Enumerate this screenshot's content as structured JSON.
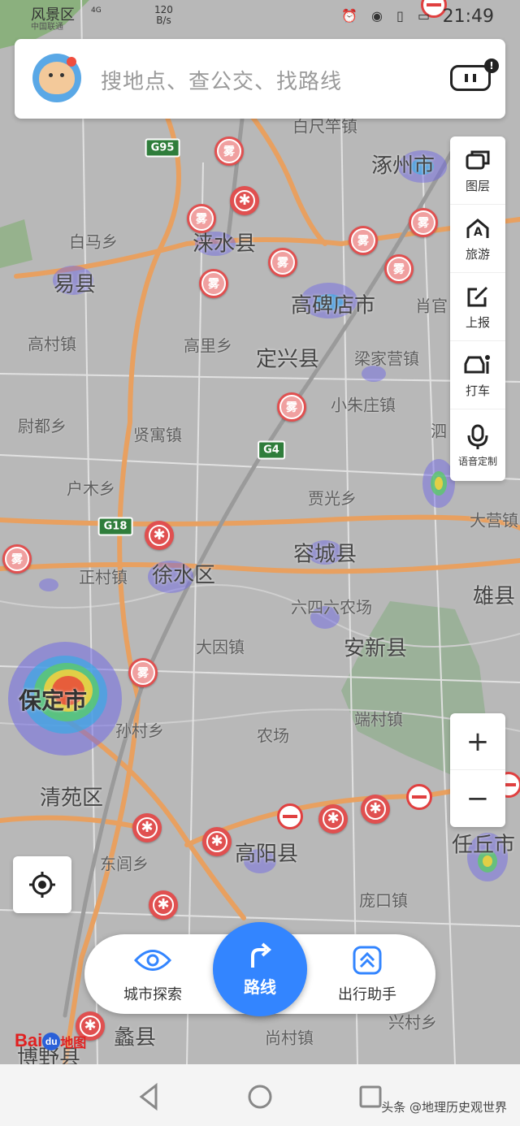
{
  "status_bar": {
    "carrier": "风景区",
    "carrier_sub": "中国联通",
    "network": "4G",
    "speed_value": "120",
    "speed_unit": "B/s",
    "time": "21:49"
  },
  "search": {
    "placeholder": "搜地点、查公交、找路线",
    "badge": "!"
  },
  "tools": [
    {
      "label": "图层",
      "icon": "layers-icon"
    },
    {
      "label": "旅游",
      "icon": "travel-icon"
    },
    {
      "label": "上报",
      "icon": "report-icon"
    },
    {
      "label": "打车",
      "icon": "taxi-icon"
    },
    {
      "label": "语音定制",
      "icon": "microphone-icon"
    }
  ],
  "zoom": {
    "in": "+",
    "out": "−"
  },
  "bottom_bar": {
    "explore_label": "城市探索",
    "route_label": "路线",
    "assistant_label": "出行助手"
  },
  "logo": {
    "bai": "Bai",
    "du": "du",
    "map": "地图"
  },
  "map": {
    "labels": [
      {
        "text": "白尺竿镇",
        "cls": ""
      },
      {
        "text": "涿州市",
        "cls": "major"
      },
      {
        "text": "白马乡",
        "cls": ""
      },
      {
        "text": "涞水县",
        "cls": "major"
      },
      {
        "text": "易县",
        "cls": "major"
      },
      {
        "text": "高碑店市",
        "cls": "major"
      },
      {
        "text": "肖官",
        "cls": ""
      },
      {
        "text": "高村镇",
        "cls": ""
      },
      {
        "text": "高里乡",
        "cls": ""
      },
      {
        "text": "定兴县",
        "cls": "major"
      },
      {
        "text": "梁家营镇",
        "cls": ""
      },
      {
        "text": "尉都乡",
        "cls": ""
      },
      {
        "text": "贤寓镇",
        "cls": ""
      },
      {
        "text": "小朱庄镇",
        "cls": ""
      },
      {
        "text": "泗",
        "cls": ""
      },
      {
        "text": "户木乡",
        "cls": ""
      },
      {
        "text": "贾光乡",
        "cls": ""
      },
      {
        "text": "大营镇",
        "cls": ""
      },
      {
        "text": "正村镇",
        "cls": ""
      },
      {
        "text": "徐水区",
        "cls": "major"
      },
      {
        "text": "容城县",
        "cls": "major"
      },
      {
        "text": "雄县",
        "cls": "major"
      },
      {
        "text": "六四六农场",
        "cls": ""
      },
      {
        "text": "大因镇",
        "cls": ""
      },
      {
        "text": "安新县",
        "cls": "major"
      },
      {
        "text": "保定市",
        "cls": "big"
      },
      {
        "text": "孙村乡",
        "cls": ""
      },
      {
        "text": "农场",
        "cls": ""
      },
      {
        "text": "端村镇",
        "cls": ""
      },
      {
        "text": "清苑区",
        "cls": "major"
      },
      {
        "text": "任丘市",
        "cls": "major"
      },
      {
        "text": "东闾乡",
        "cls": ""
      },
      {
        "text": "高阳县",
        "cls": "major"
      },
      {
        "text": "庞口镇",
        "cls": ""
      },
      {
        "text": "蠡县",
        "cls": "major"
      },
      {
        "text": "尚村镇",
        "cls": ""
      },
      {
        "text": "博野县",
        "cls": "major"
      },
      {
        "text": "兴村乡",
        "cls": ""
      }
    ],
    "shields": [
      "G95",
      "G4",
      "G18"
    ],
    "fog_text": "雾"
  },
  "watermark": "头条 @地理历史观世界"
}
